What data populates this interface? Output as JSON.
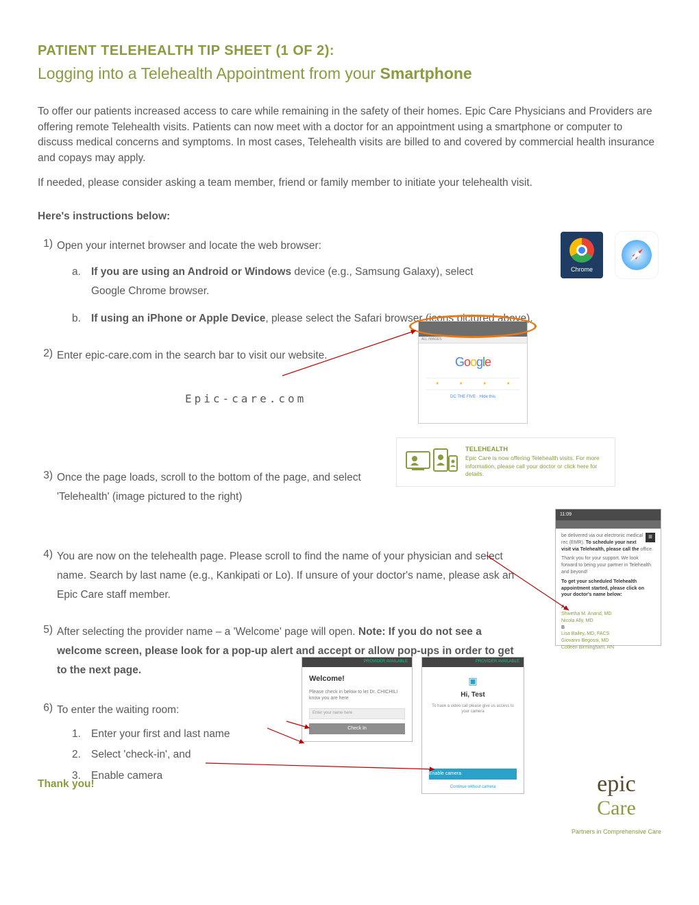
{
  "title": "PATIENT TELEHEALTH TIP SHEET (1 OF 2):",
  "subtitle_plain": "Logging into a Telehealth Appointment from your ",
  "subtitle_bold": "Smartphone",
  "intro1": "To offer our patients increased access to care while remaining in the safety of their homes. Epic Care Physicians and Providers are offering remote Telehealth visits. Patients can now meet with a doctor for an appointment using a smartphone or computer to discuss medical concerns and symptoms. In most cases, Telehealth visits are billed to and covered by commercial health insurance and copays may apply.",
  "intro2": "If needed, please consider asking a team member, friend or family member to initiate your telehealth visit.",
  "section_head": "Here's instructions below:",
  "steps": {
    "s1": {
      "num": "1)",
      "text": "Open your internet browser and locate the web browser:",
      "a_letter": "a.",
      "a_bold": "If you are using an Android or Windows",
      "a_rest": " device (e.g., Samsung Galaxy), select Google Chrome browser.",
      "b_letter": "b.",
      "b_bold": "If using an iPhone or Apple Device",
      "b_rest": ", please select the Safari browser (icons pictured above)."
    },
    "s2": {
      "num": "2)",
      "text": "Enter  epic-care.com in the search bar to visit our website.",
      "url_label": "Epic-care.com"
    },
    "s3": {
      "num": "3)",
      "text": "Once the page loads, scroll to the bottom of the page, and select 'Telehealth' (image pictured to the right)"
    },
    "s4": {
      "num": "4)",
      "text": "You are now on the telehealth page. Please scroll to find the name of your physician and select name. Search by last name (e.g., Kankipati or Lo). If unsure of your doctor's name, please ask an Epic Care staff member."
    },
    "s5": {
      "num": "5)",
      "text_a": "After selecting the provider name – a 'Welcome' page will open. ",
      "text_bold": "Note: If you do not see a welcome screen, please look for a pop-up alert and accept or allow pop-ups in order to get to the next page."
    },
    "s6": {
      "num": "6)",
      "text": "To enter the waiting room:",
      "i1n": "1.",
      "i1": "Enter your first and last name",
      "i2n": "2.",
      "i2": "Select 'check-in', and",
      "i3n": "3.",
      "i3": "Enable camera"
    }
  },
  "icons": {
    "chrome_label": "Chrome"
  },
  "banner": {
    "heading": "TELEHEALTH",
    "body": "Epic Care is now offering Telehealth visits. For more information, please call your doctor or click here for details."
  },
  "phone_s4": {
    "time": "11:09",
    "line1": "be delivered via our electronic medical rec",
    "line2a": "(EMR). ",
    "line2b": "To schedule your next visit via Telehealth, please call the ",
    "line2c": "office.",
    "line3": "Thank you for your support. We look forward to being your partner in Telehealth and beyond!",
    "line4": "To get your scheduled Telehealth appointment started, please click on your doctor's name below:",
    "labA": "A",
    "names_a": [
      "Shwetha M. Anand, MD",
      "Nicola Ally, MD"
    ],
    "labB": "B",
    "names_b": [
      "Lisa Bailey, MD, FACS",
      "Giovanni Begossi, MD",
      "Colleen Birmingham, RN"
    ]
  },
  "phone_s6a": {
    "status": "PROVIDER AVAILABLE",
    "welcome": "Welcome!",
    "sub": "Please check in below to let Dr. CHICHILI know you are here",
    "placeholder": "Enter your name here",
    "btn": "Check In"
  },
  "phone_s6b": {
    "status": "PROVIDER AVAILABLE",
    "hi": "Hi, Test",
    "sub": "To have a video call please give us access to your camera",
    "enable": "Enable camera",
    "link": "Continue without camera"
  },
  "thank": "Thank you!",
  "logo": {
    "line1": "epic",
    "line2": "Care",
    "tag": "Partners in Comprehensive Care"
  }
}
